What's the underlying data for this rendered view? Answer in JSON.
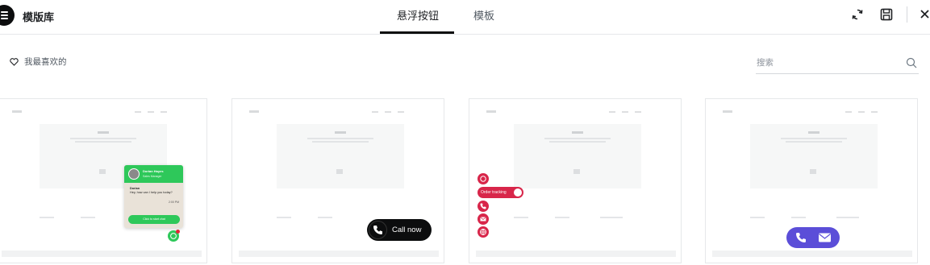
{
  "app": {
    "title": "模版库",
    "tabs": [
      {
        "label": "悬浮按钮",
        "active": true
      },
      {
        "label": "模板",
        "active": false
      }
    ],
    "toolbar": {
      "sync_icon": "sync-icon",
      "save_icon": "save-icon",
      "close_icon": "close-icon"
    }
  },
  "filter": {
    "favorites_label": "我最喜欢的",
    "favorites_icon": "heart-icon"
  },
  "search": {
    "placeholder": "搜索",
    "value": "",
    "icon": "search-icon"
  },
  "cards": [
    {
      "preview": "whatsapp-chat",
      "chat": {
        "name": "Dorian Hayes",
        "role": "Sales Manager",
        "sender": "Dorian",
        "message": "Hey, how can I help you today?",
        "time": "2:00 PM",
        "button": "Click to start chat"
      }
    },
    {
      "preview": "call-now",
      "button_label": "Call now"
    },
    {
      "preview": "stacked-buttons",
      "pill_label": "Order tracking",
      "buttons": [
        "whatsapp-icon",
        "messenger-icon",
        "phone-icon",
        "email-icon",
        "globe-icon"
      ]
    },
    {
      "preview": "phone-email-bar",
      "buttons": [
        "phone-icon",
        "email-icon"
      ]
    }
  ],
  "colors": {
    "whatsapp_green": "#2ec85a",
    "stack_red": "#d8264a",
    "purple": "#5b4ed8",
    "dark": "#0c0d0e"
  }
}
